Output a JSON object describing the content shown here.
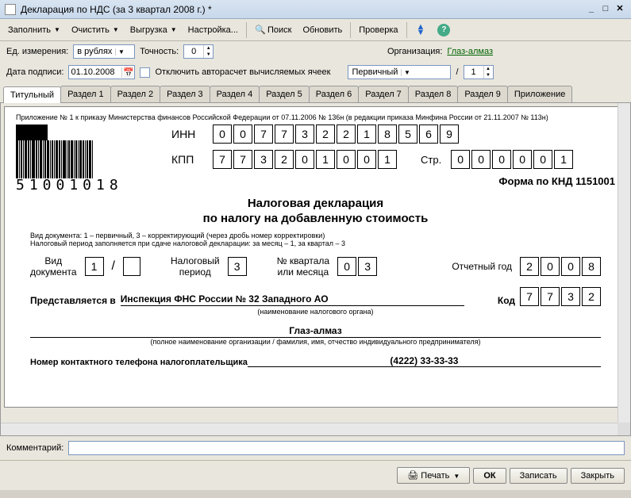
{
  "window": {
    "title": "Декларация по НДС (за 3 квартал 2008 г.) *"
  },
  "toolbar": {
    "fill": "Заполнить",
    "clear": "Очистить",
    "export": "Выгрузка",
    "settings": "Настройка...",
    "search": "Поиск",
    "refresh": "Обновить",
    "check": "Проверка"
  },
  "params": {
    "unit_label": "Ед. измерения:",
    "unit_value": "в рублях",
    "precision_label": "Точность:",
    "precision_value": "0",
    "org_label": "Организация:",
    "org_value": "Глаз-алмаз",
    "sign_date_label": "Дата подписи:",
    "sign_date_value": "01.10.2008",
    "autocalc_label": "Отключить авторасчет вычисляемых ячеек",
    "doc_type_value": "Первичный",
    "slash": "/",
    "corr_value": "1"
  },
  "tabs": [
    "Титульный",
    "Раздел 1",
    "Раздел 2",
    "Раздел 3",
    "Раздел 4",
    "Раздел 5",
    "Раздел 6",
    "Раздел 7",
    "Раздел 8",
    "Раздел 9",
    "Приложение"
  ],
  "doc": {
    "appendix_note": "Приложение № 1 к приказу Министерства финансов Российской Федерации от 07.11.2006 № 136н (в редакции приказа Минфина России от 21.11.2007 № 113н)",
    "barcode_num": "51001018",
    "inn_label": "ИНН",
    "inn": [
      "0",
      "0",
      "7",
      "7",
      "3",
      "2",
      "2",
      "1",
      "8",
      "5",
      "6",
      "9"
    ],
    "kpp_label": "КПП",
    "kpp": [
      "7",
      "7",
      "3",
      "2",
      "0",
      "1",
      "0",
      "0",
      "1"
    ],
    "page_label": "Стр.",
    "page": [
      "0",
      "0",
      "0",
      "0",
      "0",
      "1"
    ],
    "knd": "Форма по КНД 1151001",
    "title1": "Налоговая декларация",
    "title2": "по налогу на добавленную стоимость",
    "hint1": "Вид документа: 1 – первичный, 3 – корректирующий (через дробь номер корректировки)",
    "hint2": "Налоговый период заполняется при сдаче налоговой декларации: за месяц – 1, за квартал – 3",
    "doc_kind_label": "Вид\nдокумента",
    "doc_kind_v1": "1",
    "doc_kind_v2": "",
    "tax_period_label": "Налоговый\nпериод",
    "tax_period_value": "3",
    "quarter_label": "№ квартала\nили месяца",
    "quarter_v1": "0",
    "quarter_v2": "3",
    "year_label": "Отчетный год",
    "year": [
      "2",
      "0",
      "0",
      "8"
    ],
    "rep_label": "Представляется в",
    "rep_org": "Инспекция ФНС России № 32 Западного АО",
    "rep_sublabel": "(наименование налогового органа)",
    "code_label": "Код",
    "code": [
      "7",
      "7",
      "3",
      "2"
    ],
    "org_name": "Глаз-алмаз",
    "org_sublabel": "(полное наименование организации / фамилия, имя, отчество индивидуального предпринимателя)",
    "phone_label": "Номер контактного телефона налогоплательщика",
    "phone_value": "(4222) 33-33-33"
  },
  "comment": {
    "label": "Комментарий:",
    "value": ""
  },
  "footer": {
    "print": "Печать",
    "ok": "ОК",
    "save": "Записать",
    "close": "Закрыть"
  }
}
